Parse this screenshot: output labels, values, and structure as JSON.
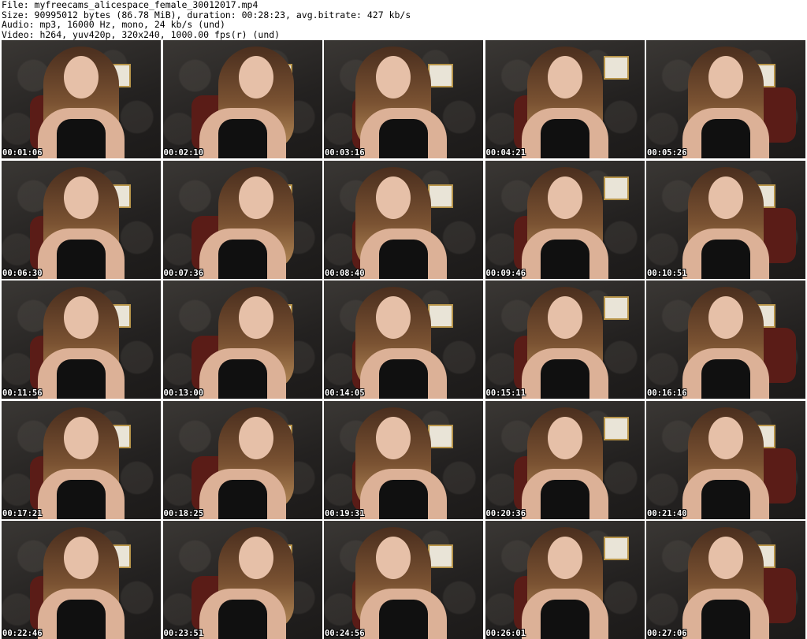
{
  "header": {
    "file": "File: myfreecams_alicespace_female_30012017.mp4",
    "size": "Size: 90995012 bytes (86.78 MiB), duration: 00:28:23, avg.bitrate: 427 kb/s",
    "audio": "Audio: mp3, 16000 Hz, mono, 24 kb/s (und)",
    "video": "Video: h264, yuv420p, 320x240, 1000.00 fps(r) (und)"
  },
  "thumbnails": [
    {
      "timestamp": "00:01:06"
    },
    {
      "timestamp": "00:02:10"
    },
    {
      "timestamp": "00:03:16"
    },
    {
      "timestamp": "00:04:21"
    },
    {
      "timestamp": "00:05:26"
    },
    {
      "timestamp": "00:06:30"
    },
    {
      "timestamp": "00:07:36"
    },
    {
      "timestamp": "00:08:40"
    },
    {
      "timestamp": "00:09:46"
    },
    {
      "timestamp": "00:10:51"
    },
    {
      "timestamp": "00:11:56"
    },
    {
      "timestamp": "00:13:00"
    },
    {
      "timestamp": "00:14:05"
    },
    {
      "timestamp": "00:15:11"
    },
    {
      "timestamp": "00:16:16"
    },
    {
      "timestamp": "00:17:21"
    },
    {
      "timestamp": "00:18:25"
    },
    {
      "timestamp": "00:19:31"
    },
    {
      "timestamp": "00:20:36"
    },
    {
      "timestamp": "00:21:40"
    },
    {
      "timestamp": "00:22:46"
    },
    {
      "timestamp": "00:23:51"
    },
    {
      "timestamp": "00:24:56"
    },
    {
      "timestamp": "00:26:01"
    },
    {
      "timestamp": "00:27:06"
    }
  ]
}
